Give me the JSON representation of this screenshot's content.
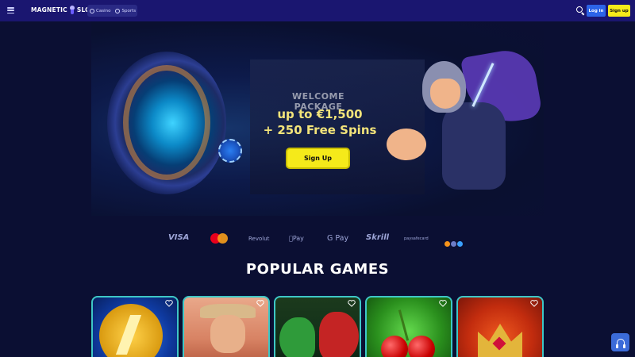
{
  "header": {
    "logo_text_left": "MAGNETIC",
    "logo_text_right": "SLOTS",
    "nav": [
      {
        "label": "Casino",
        "icon": "casino-chip-icon"
      },
      {
        "label": "Sports",
        "icon": "soccer-ball-icon"
      }
    ],
    "login_label": "Log in",
    "signup_label": "Sign up",
    "colors": {
      "header_bg": "#1a1670",
      "login_bg": "#2c64e8",
      "signup_bg": "#f5ea1a"
    }
  },
  "hero": {
    "subtitle": "WELCOME PACKAGE",
    "line1": "up to €1,500",
    "line2": "+ 250 Free Spins",
    "cta_label": "Sign Up"
  },
  "payments": [
    "VISA",
    "Mastercard",
    "Revolut",
    "Pay",
    "G Pay",
    "Skrill",
    "paysafecard"
  ],
  "section_title": "POPULAR GAMES",
  "games": [
    {
      "name": "game-lightning-coin",
      "favorited": false
    },
    {
      "name": "game-cowboy",
      "favorited": false
    },
    {
      "name": "game-dragons",
      "favorited": false
    },
    {
      "name": "game-cherries",
      "favorited": false
    },
    {
      "name": "game-crown",
      "favorited": false
    }
  ],
  "support": {
    "icon": "headset-icon"
  }
}
